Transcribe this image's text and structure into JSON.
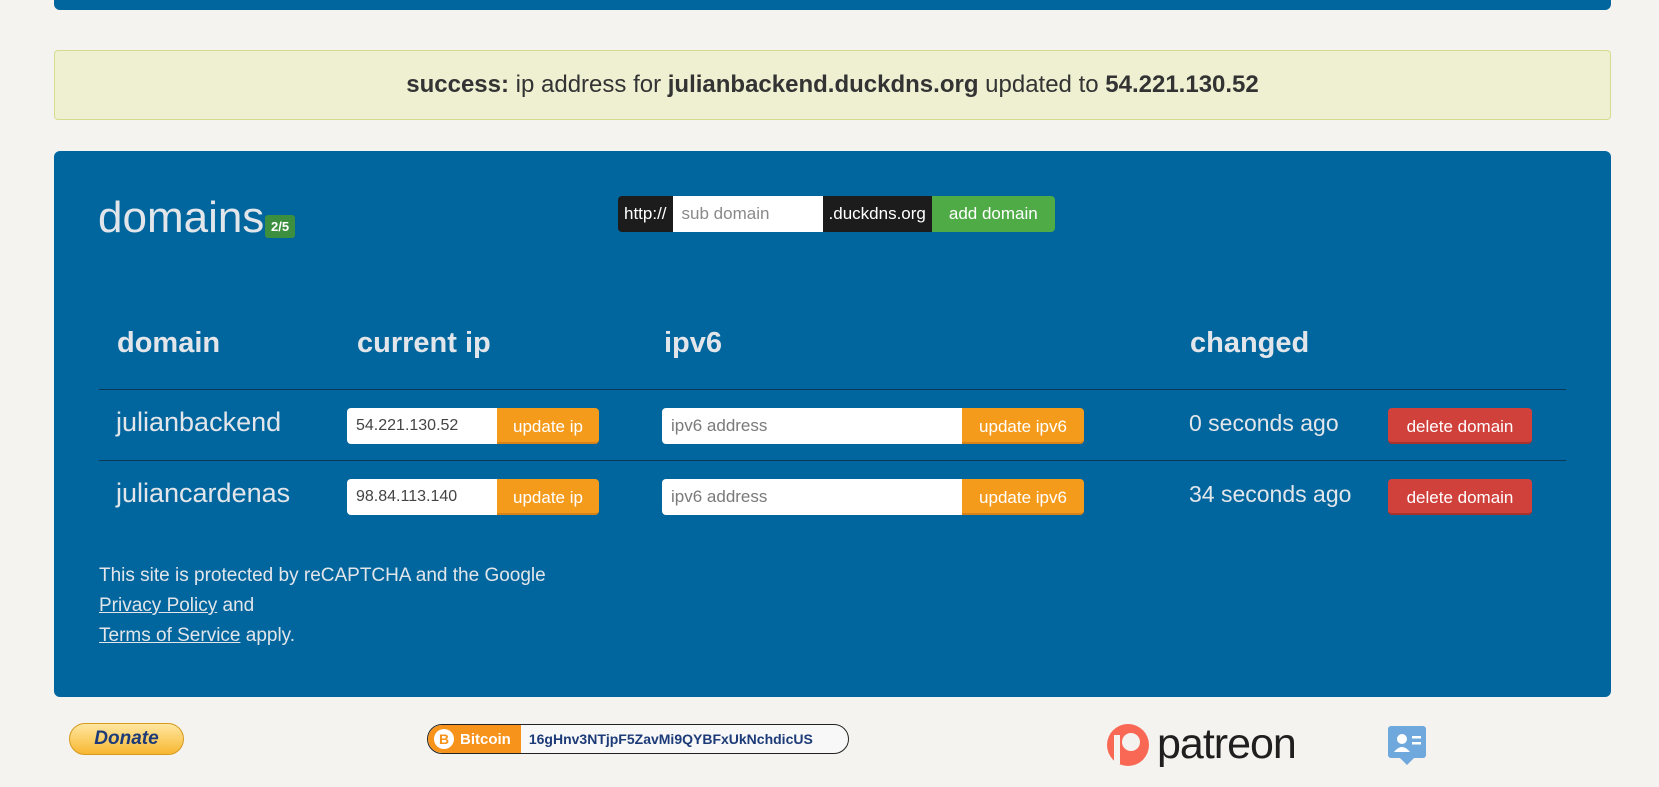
{
  "alert": {
    "prefix": "success:",
    "text1": " ip address for ",
    "domain": "julianbackend.duckdns.org",
    "text2": " updated to ",
    "ip": "54.221.130.52"
  },
  "panel": {
    "title": "domains",
    "count": "2/5",
    "add": {
      "prefix": "http://",
      "placeholder": "sub domain",
      "suffix": ".duckdns.org",
      "button": "add domain"
    }
  },
  "table": {
    "headers": {
      "domain": "domain",
      "current_ip": "current ip",
      "ipv6": "ipv6",
      "changed": "changed"
    },
    "rows": [
      {
        "domain": "julianbackend",
        "ip": "54.221.130.52",
        "update_ip": "update ip",
        "ipv6_placeholder": "ipv6 address",
        "update_ipv6": "update ipv6",
        "changed": "0 seconds ago",
        "delete": "delete domain"
      },
      {
        "domain": "juliancardenas",
        "ip": "98.84.113.140",
        "update_ip": "update ip",
        "ipv6_placeholder": "ipv6 address",
        "update_ipv6": "update ipv6",
        "changed": "34 seconds ago",
        "delete": "delete domain"
      }
    ]
  },
  "recaptcha": {
    "line1": "This site is protected by reCAPTCHA and the Google",
    "privacy": "Privacy Policy",
    "and": " and",
    "terms": "Terms of Service",
    "apply": " apply."
  },
  "footer": {
    "donate": "Donate",
    "bitcoin_label": "Bitcoin",
    "bitcoin_symbol": "B",
    "bitcoin_address": "16gHnv3NTjpF5ZavMi9QYBFxUkNchdicUS",
    "patreon": "patreon"
  },
  "colors": {
    "panel": "#02669e",
    "green": "#4eab46",
    "orange": "#f49b1c",
    "red": "#d1413c",
    "patreon": "#f96854"
  },
  "icons": [
    "patreon-logo-icon",
    "bitcoin-icon",
    "contact-icon"
  ]
}
